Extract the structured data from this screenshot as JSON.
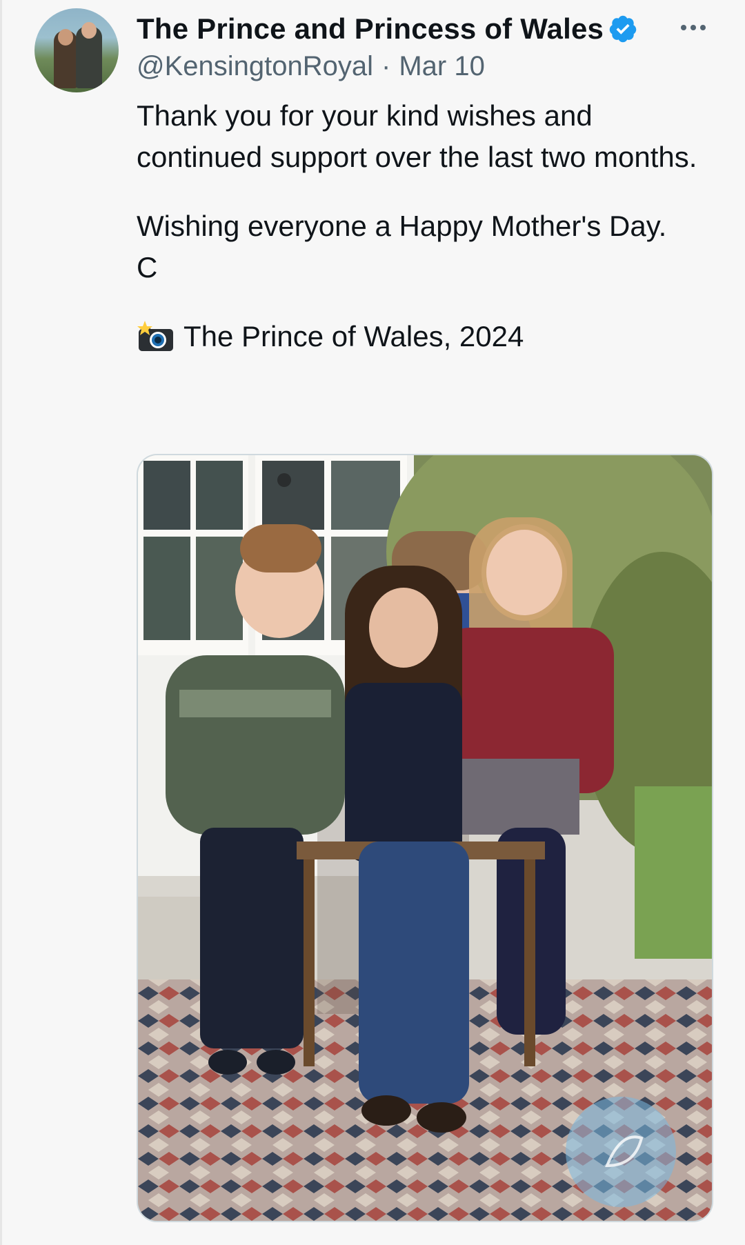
{
  "tweet": {
    "display_name": "The Prince and Princess of Wales",
    "verified_icon": "verified-badge-icon",
    "handle": "@KensingtonRoyal",
    "separator": "·",
    "date": "Mar 10",
    "more_icon": "more-horizontal-icon",
    "text_line1": "Thank you for your kind wishes and continued support over the last two months.",
    "text_line2": "Wishing everyone a Happy Mother's Day.",
    "text_line3": "C",
    "credit_icon": "camera-flash-icon",
    "credit": "The Prince of Wales, 2024",
    "image_icon": "family-photo",
    "watermark_icon": "edited-image-icon"
  },
  "colors": {
    "accent": "#1d9bf0",
    "text": "#0f1419",
    "secondary": "#536471",
    "background": "#f7f7f7"
  }
}
